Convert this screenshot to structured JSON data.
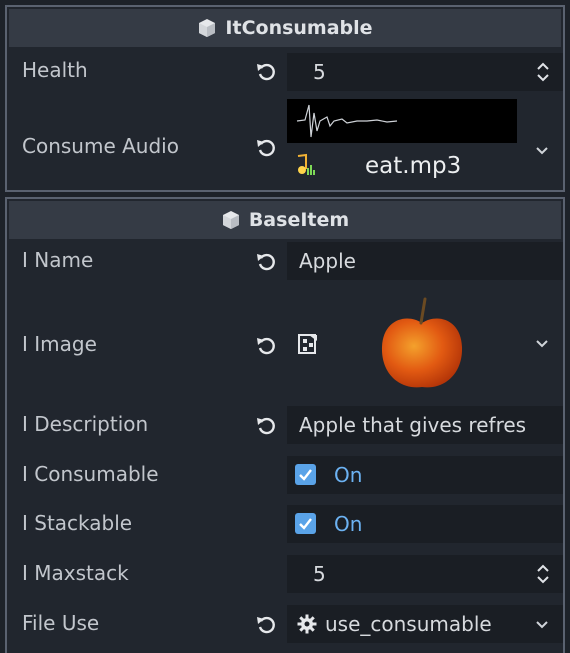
{
  "itconsumable": {
    "title": "ItConsumable",
    "health": {
      "label": "Health",
      "value": "5"
    },
    "consume_audio": {
      "label": "Consume Audio",
      "file": "eat.mp3"
    }
  },
  "baseitem": {
    "title": "BaseItem",
    "name": {
      "label": "I Name",
      "value": "Apple"
    },
    "image": {
      "label": "I Image"
    },
    "description": {
      "label": "I Description",
      "value": "Apple that gives refres"
    },
    "consumable": {
      "label": "I Consumable",
      "value": "On"
    },
    "stackable": {
      "label": "I Stackable",
      "value": "On"
    },
    "maxstack": {
      "label": "I Maxstack",
      "value": "5"
    },
    "file_use": {
      "label": "File Use",
      "value": "use_consumable"
    }
  },
  "icons": {
    "header": "cube-icon",
    "revert": "revert-icon",
    "audio": "audio-stream-icon",
    "texture": "texture-icon",
    "script": "gear-icon",
    "dropdown": "chevron-down-icon",
    "spinner": "updown-icon"
  },
  "colors": {
    "accent": "#5aa3e8",
    "on_text": "#6cb2f2",
    "panel_bg": "#21262e",
    "header_bg": "#353b45"
  }
}
